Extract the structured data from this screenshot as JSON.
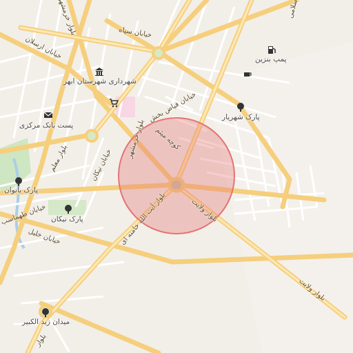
{
  "map": {
    "labels": {
      "shahrdari": "شهرداری شهرستان ابهر",
      "post": "پست بانک مرکزی",
      "park_banovan": "پارک بانوان",
      "park_nikan": "پارک نیکان",
      "park_shahriar": "پارک شهریار",
      "pomp": "پمپ بنزین",
      "meydan": "میدان زید الکبیر"
    },
    "roads": {
      "khorramshahr_top": "بلوار خرمشهر",
      "sepah": "خیابان سپاه",
      "arsalan": "خیابان ارسلان",
      "fayaz": "خیابان فیاض بخش",
      "kooche": "کوچه میثم",
      "khorramshahr_mid": "بلوار خرمشهر",
      "moallem": "بلوار معلم",
      "nikan": "خیابان نیکان",
      "vilayat": "بلوار ولایت",
      "vilayat2": "بلوار ولایت",
      "ayatollah": "بلوار آیت الله خامنه ای",
      "taleghani": "خیابان طهماسب",
      "khalil": "خیابان خلیل",
      "eslami": "اسلامی",
      "bolvar_bottom": "بلوار"
    },
    "icons": {
      "shahrdari": "government-icon",
      "post": "post-office-icon",
      "park": "tree-icon",
      "pomp": "fuel-icon",
      "cafe": "cafe-icon",
      "shop": "cart-icon"
    },
    "highlight_color": "#e57373"
  }
}
